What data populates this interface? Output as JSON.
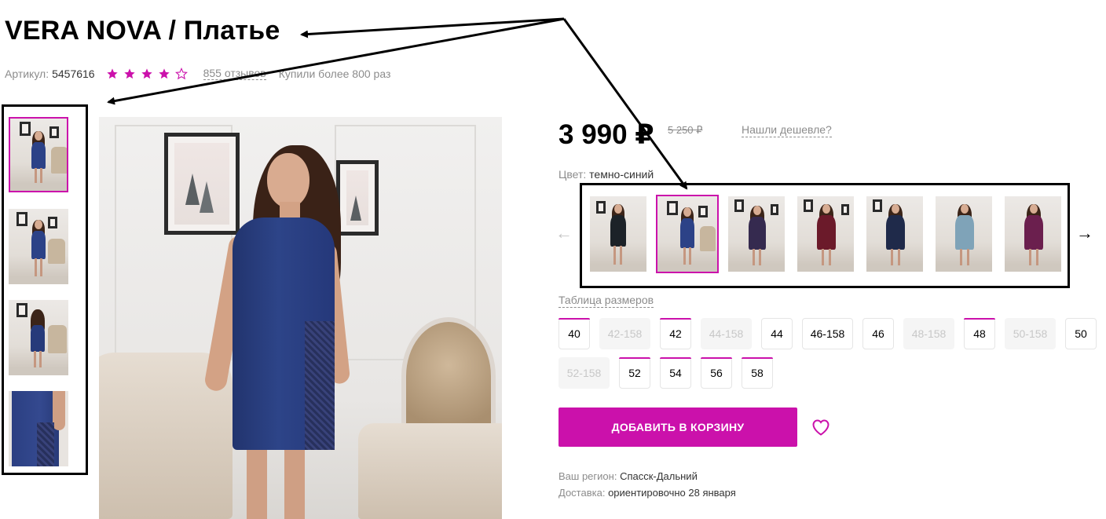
{
  "product": {
    "title": "VERA NOVA / Платье",
    "article_label": "Артикул:",
    "article_value": "5457616",
    "rating": 4,
    "rating_max": 5,
    "reviews": "855 отзывов",
    "bought": "Купили более 800 раз"
  },
  "gallery": {
    "thumbnails": [
      "photo-1",
      "photo-2",
      "photo-3",
      "photo-4"
    ],
    "active_index": 0
  },
  "price": {
    "current": "3 990 ₽",
    "old": "5 250 ₽",
    "cheaper_link": "Нашли дешевле?"
  },
  "color": {
    "label": "Цвет:",
    "value": "темно-синий",
    "options": [
      "black",
      "dark-blue",
      "purple",
      "burgundy",
      "navy",
      "light-blue",
      "plum"
    ],
    "active_index": 1
  },
  "sizes": {
    "table_link": "Таблица размеров",
    "items": [
      {
        "label": "40",
        "available": true,
        "mark": true
      },
      {
        "label": "42-158",
        "available": false,
        "mark": false
      },
      {
        "label": "42",
        "available": true,
        "mark": true
      },
      {
        "label": "44-158",
        "available": false,
        "mark": false
      },
      {
        "label": "44",
        "available": true,
        "mark": false
      },
      {
        "label": "46-158",
        "available": true,
        "mark": false
      },
      {
        "label": "46",
        "available": true,
        "mark": false
      },
      {
        "label": "48-158",
        "available": false,
        "mark": false
      },
      {
        "label": "48",
        "available": true,
        "mark": true
      },
      {
        "label": "50-158",
        "available": false,
        "mark": false
      },
      {
        "label": "50",
        "available": true,
        "mark": false
      },
      {
        "label": "52-158",
        "available": false,
        "mark": false
      },
      {
        "label": "52",
        "available": true,
        "mark": true
      },
      {
        "label": "54",
        "available": true,
        "mark": true
      },
      {
        "label": "56",
        "available": true,
        "mark": true
      },
      {
        "label": "58",
        "available": true,
        "mark": true
      }
    ]
  },
  "actions": {
    "add_to_cart": "ДОБАВИТЬ В КОРЗИНУ"
  },
  "delivery": {
    "region_label": "Ваш регион:",
    "region_value": "Спасск-Дальний",
    "delivery_label": "Доставка:",
    "delivery_value": "ориентировочно 28 января"
  },
  "colors": {
    "accent": "#cb11ab",
    "star": "#cb11ab",
    "muted_text": "#8c8c8c"
  }
}
